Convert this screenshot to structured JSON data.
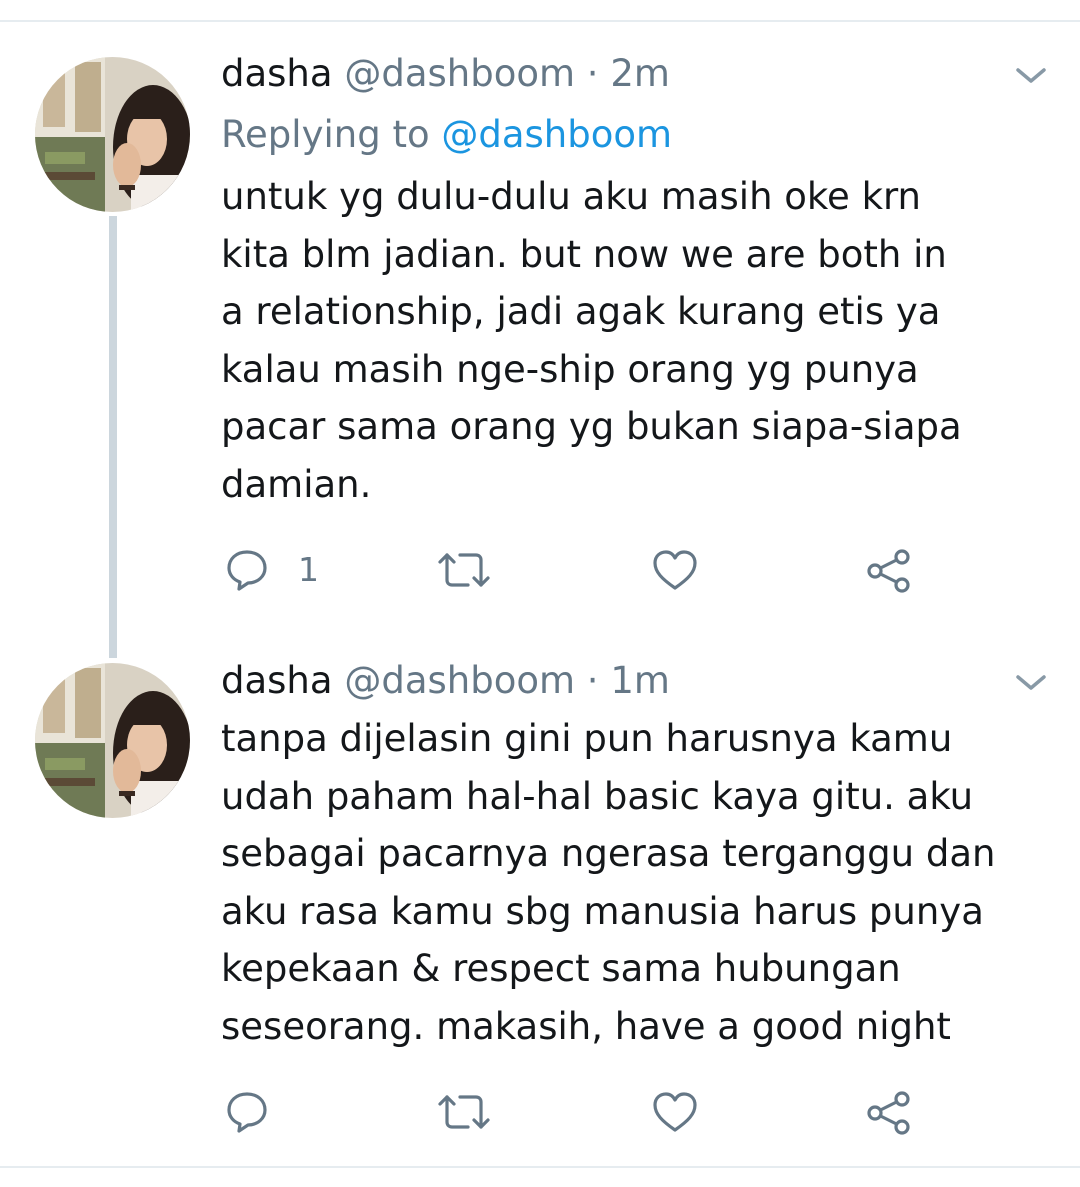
{
  "tweets": [
    {
      "name": "dasha",
      "handle": "@dashboom",
      "separator": "·",
      "time": "2m",
      "replying_prefix": "Replying to",
      "replying_to": "@dashboom",
      "text_lines": [
        "untuk yg dulu-dulu aku masih oke krn",
        "kita blm jadian. but now we are both in",
        "a relationship, jadi agak kurang etis ya",
        "kalau masih nge-ship orang yg punya",
        "pacar sama orang yg bukan siapa-siapa",
        "damian."
      ],
      "reply_count": "1",
      "icons": [
        "reply-icon",
        "retweet-icon",
        "like-icon",
        "share-icon",
        "chevron-down-icon"
      ]
    },
    {
      "name": "dasha",
      "handle": "@dashboom",
      "separator": "·",
      "time": "1m",
      "text_lines": [
        "tanpa dijelasin gini pun harusnya kamu",
        "udah paham hal-hal basic kaya gitu. aku",
        "sebagai pacarnya ngerasa terganggu dan",
        "aku rasa kamu sbg manusia harus punya",
        "kepekaan & respect sama hubungan",
        "seseorang. makasih, have a good night"
      ],
      "reply_count": "",
      "icons": [
        "reply-icon",
        "retweet-icon",
        "like-icon",
        "share-icon",
        "chevron-down-icon"
      ]
    }
  ],
  "colors": {
    "text": "#14171a",
    "secondary": "#657786",
    "link": "#1b95e0",
    "divider": "#e6ecf0",
    "thread_line": "#ccd6dd"
  }
}
